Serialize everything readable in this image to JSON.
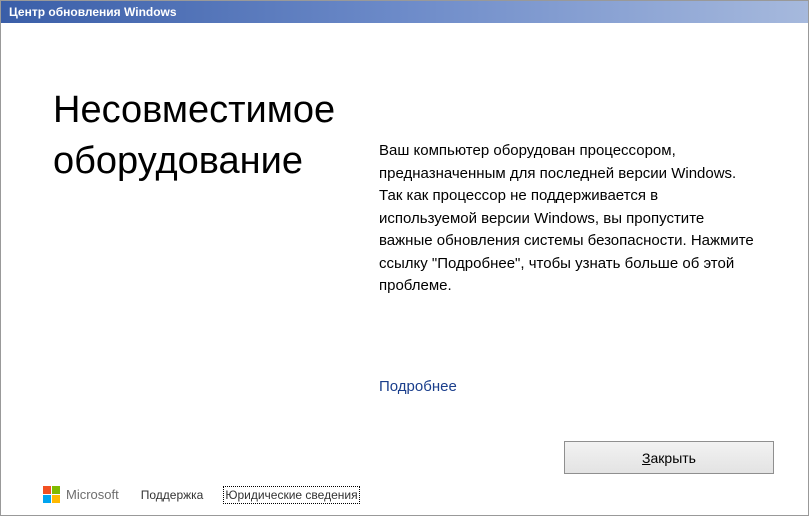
{
  "titlebar": {
    "title": "Центр обновления Windows"
  },
  "main": {
    "heading": "Несовместимое оборудование",
    "body": "Ваш компьютер оборудован процессором, предназначенным для последней версии Windows. Так как процессор не поддерживается в используемой версии Windows, вы пропустите важные обновления системы безопасности. Нажмите ссылку \"Подробнее\", чтобы узнать больше об этой проблеме.",
    "learn_more": "Подробнее",
    "close_prefix": "З",
    "close_rest": "акрыть"
  },
  "footer": {
    "brand": "Microsoft",
    "support": "Поддержка",
    "legal": "Юридические сведения"
  },
  "colors": {
    "titlebar_start": "#3a5ea8",
    "titlebar_end": "#a6b9dd",
    "link": "#1a3e8c"
  }
}
